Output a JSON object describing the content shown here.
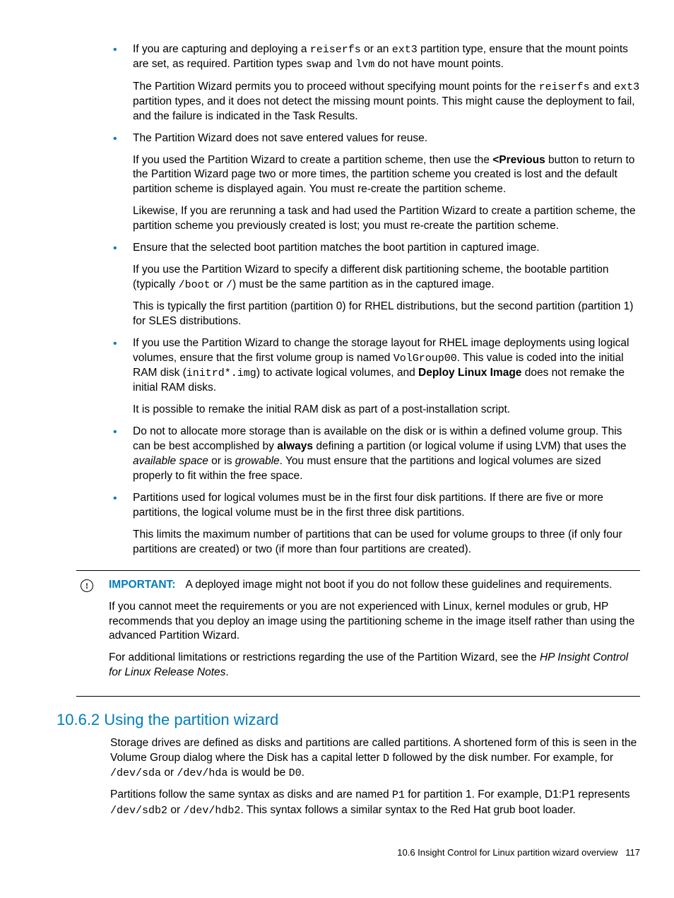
{
  "bullets": [
    {
      "paras": [
        {
          "segs": [
            {
              "t": "If you are capturing and deploying a "
            },
            {
              "t": "reiserfs",
              "cls": "mono"
            },
            {
              "t": " or an "
            },
            {
              "t": "ext3",
              "cls": "mono"
            },
            {
              "t": " partition type, ensure that the mount points are set, as required. Partition types "
            },
            {
              "t": "swap",
              "cls": "mono"
            },
            {
              "t": " and "
            },
            {
              "t": "lvm",
              "cls": "mono"
            },
            {
              "t": " do not have mount points."
            }
          ]
        },
        {
          "segs": [
            {
              "t": "The Partition Wizard permits you to proceed without specifying mount points for the "
            },
            {
              "t": "reiserfs",
              "cls": "mono"
            },
            {
              "t": " and "
            },
            {
              "t": "ext3",
              "cls": "mono"
            },
            {
              "t": " partition types, and it does not detect the missing mount points. This might cause the deployment to fail, and the failure is indicated in the Task Results."
            }
          ]
        }
      ]
    },
    {
      "paras": [
        {
          "segs": [
            {
              "t": "The Partition Wizard does not save entered values for reuse."
            }
          ]
        },
        {
          "segs": [
            {
              "t": "If you used the Partition Wizard to create a partition scheme, then use the "
            },
            {
              "t": "<Previous",
              "cls": "bold"
            },
            {
              "t": " button to return to the Partition Wizard page two or more times, the partition scheme you created is lost and the default partition scheme is displayed again. You must re-create the partition scheme."
            }
          ]
        },
        {
          "segs": [
            {
              "t": "Likewise, If you are rerunning a task and had used the Partition Wizard to create a partition scheme, the partition scheme you previously created is lost; you must re-create the partition scheme."
            }
          ]
        }
      ]
    },
    {
      "paras": [
        {
          "segs": [
            {
              "t": "Ensure that the selected boot partition matches the boot partition in captured image."
            }
          ]
        },
        {
          "segs": [
            {
              "t": "If you use the Partition Wizard to specify a different disk partitioning scheme, the bootable partition (typically "
            },
            {
              "t": "/boot",
              "cls": "mono"
            },
            {
              "t": " or "
            },
            {
              "t": "/",
              "cls": "mono"
            },
            {
              "t": ") must be the same partition as in the captured image."
            }
          ]
        },
        {
          "segs": [
            {
              "t": "This is typically the first partition (partition 0) for RHEL distributions, but the second partition (partition 1) for SLES distributions."
            }
          ]
        }
      ]
    },
    {
      "paras": [
        {
          "segs": [
            {
              "t": "If you use the Partition Wizard to change the storage layout for RHEL image deployments using logical volumes, ensure that the first volume group is named "
            },
            {
              "t": "VolGroup00",
              "cls": "mono"
            },
            {
              "t": ". This value is coded into the initial RAM disk ("
            },
            {
              "t": "initrd*.img",
              "cls": "mono"
            },
            {
              "t": ") to activate logical volumes, and "
            },
            {
              "t": "Deploy Linux Image",
              "cls": "bold"
            },
            {
              "t": " does not remake the initial RAM disks."
            }
          ]
        },
        {
          "segs": [
            {
              "t": "It is possible to remake the initial RAM disk as part of a post-installation script."
            }
          ]
        }
      ]
    },
    {
      "paras": [
        {
          "segs": [
            {
              "t": "Do not to allocate more storage than is available on the disk or is within a defined volume group. This can be best accomplished by "
            },
            {
              "t": "always",
              "cls": "bold"
            },
            {
              "t": " defining a partition (or logical volume if using LVM) that uses the "
            },
            {
              "t": "available space",
              "cls": "italic"
            },
            {
              "t": " or is "
            },
            {
              "t": "growable",
              "cls": "italic"
            },
            {
              "t": ". You must ensure that the partitions and logical volumes are sized properly to fit within the free space."
            }
          ]
        }
      ]
    },
    {
      "paras": [
        {
          "segs": [
            {
              "t": "Partitions used for logical volumes must be in the first four disk partitions. If there are five or more partitions, the logical volume must be in the first three disk partitions."
            }
          ]
        },
        {
          "segs": [
            {
              "t": "This limits the maximum number of partitions that can be used for volume groups to three (if only four partitions are created) or two (if more than four partitions are created)."
            }
          ]
        }
      ]
    }
  ],
  "important": {
    "label": "IMPORTANT:",
    "paras": [
      {
        "segs": [
          {
            "t": "A deployed image might not boot if you do not follow these guidelines and requirements."
          }
        ]
      },
      {
        "segs": [
          {
            "t": "If you cannot meet the requirements or you are not experienced with Linux, kernel modules or grub, HP recommends that you deploy an image using the partitioning scheme in the image itself rather than using the advanced Partition Wizard."
          }
        ]
      },
      {
        "segs": [
          {
            "t": "For additional limitations or restrictions regarding the use of the Partition Wizard, see the "
          },
          {
            "t": "HP Insight Control for Linux Release Notes",
            "cls": "italic"
          },
          {
            "t": "."
          }
        ]
      }
    ]
  },
  "section": {
    "title": "10.6.2 Using the partition wizard",
    "paras": [
      {
        "segs": [
          {
            "t": "Storage drives are defined as disks and partitions are called partitions. A shortened form of this is seen in the Volume Group dialog where the Disk has a capital letter "
          },
          {
            "t": "D",
            "cls": "mono"
          },
          {
            "t": " followed by the disk number. For example, for "
          },
          {
            "t": "/dev/sda",
            "cls": "mono"
          },
          {
            "t": " or "
          },
          {
            "t": "/dev/hda",
            "cls": "mono"
          },
          {
            "t": " is would be "
          },
          {
            "t": "D0",
            "cls": "mono"
          },
          {
            "t": "."
          }
        ]
      },
      {
        "segs": [
          {
            "t": "Partitions follow the same syntax as disks and are named "
          },
          {
            "t": "P1",
            "cls": "mono"
          },
          {
            "t": " for partition 1. For example, D1:P1 represents "
          },
          {
            "t": "/dev/sdb2",
            "cls": "mono"
          },
          {
            "t": " or "
          },
          {
            "t": "/dev/hdb2",
            "cls": "mono"
          },
          {
            "t": ". This syntax follows a similar syntax to the Red Hat grub boot loader."
          }
        ]
      }
    ]
  },
  "footer": {
    "left": "10.6 Insight Control for Linux partition wizard overview",
    "page": "117"
  }
}
